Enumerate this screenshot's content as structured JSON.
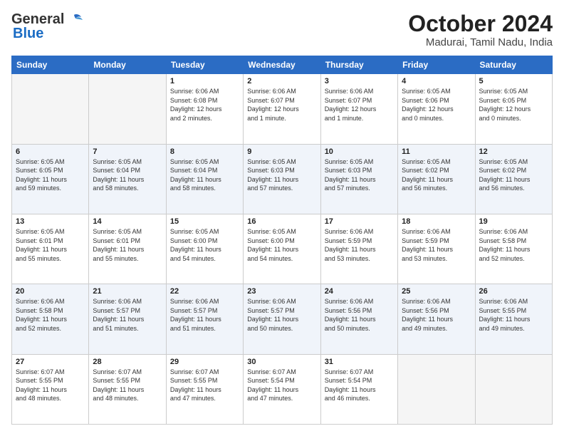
{
  "header": {
    "logo_general": "General",
    "logo_blue": "Blue",
    "month": "October 2024",
    "location": "Madurai, Tamil Nadu, India"
  },
  "weekdays": [
    "Sunday",
    "Monday",
    "Tuesday",
    "Wednesday",
    "Thursday",
    "Friday",
    "Saturday"
  ],
  "weeks": [
    [
      {
        "day": null,
        "info": ""
      },
      {
        "day": null,
        "info": ""
      },
      {
        "day": "1",
        "info": "Sunrise: 6:06 AM\nSunset: 6:08 PM\nDaylight: 12 hours\nand 2 minutes."
      },
      {
        "day": "2",
        "info": "Sunrise: 6:06 AM\nSunset: 6:07 PM\nDaylight: 12 hours\nand 1 minute."
      },
      {
        "day": "3",
        "info": "Sunrise: 6:06 AM\nSunset: 6:07 PM\nDaylight: 12 hours\nand 1 minute."
      },
      {
        "day": "4",
        "info": "Sunrise: 6:05 AM\nSunset: 6:06 PM\nDaylight: 12 hours\nand 0 minutes."
      },
      {
        "day": "5",
        "info": "Sunrise: 6:05 AM\nSunset: 6:05 PM\nDaylight: 12 hours\nand 0 minutes."
      }
    ],
    [
      {
        "day": "6",
        "info": "Sunrise: 6:05 AM\nSunset: 6:05 PM\nDaylight: 11 hours\nand 59 minutes."
      },
      {
        "day": "7",
        "info": "Sunrise: 6:05 AM\nSunset: 6:04 PM\nDaylight: 11 hours\nand 58 minutes."
      },
      {
        "day": "8",
        "info": "Sunrise: 6:05 AM\nSunset: 6:04 PM\nDaylight: 11 hours\nand 58 minutes."
      },
      {
        "day": "9",
        "info": "Sunrise: 6:05 AM\nSunset: 6:03 PM\nDaylight: 11 hours\nand 57 minutes."
      },
      {
        "day": "10",
        "info": "Sunrise: 6:05 AM\nSunset: 6:03 PM\nDaylight: 11 hours\nand 57 minutes."
      },
      {
        "day": "11",
        "info": "Sunrise: 6:05 AM\nSunset: 6:02 PM\nDaylight: 11 hours\nand 56 minutes."
      },
      {
        "day": "12",
        "info": "Sunrise: 6:05 AM\nSunset: 6:02 PM\nDaylight: 11 hours\nand 56 minutes."
      }
    ],
    [
      {
        "day": "13",
        "info": "Sunrise: 6:05 AM\nSunset: 6:01 PM\nDaylight: 11 hours\nand 55 minutes."
      },
      {
        "day": "14",
        "info": "Sunrise: 6:05 AM\nSunset: 6:01 PM\nDaylight: 11 hours\nand 55 minutes."
      },
      {
        "day": "15",
        "info": "Sunrise: 6:05 AM\nSunset: 6:00 PM\nDaylight: 11 hours\nand 54 minutes."
      },
      {
        "day": "16",
        "info": "Sunrise: 6:05 AM\nSunset: 6:00 PM\nDaylight: 11 hours\nand 54 minutes."
      },
      {
        "day": "17",
        "info": "Sunrise: 6:06 AM\nSunset: 5:59 PM\nDaylight: 11 hours\nand 53 minutes."
      },
      {
        "day": "18",
        "info": "Sunrise: 6:06 AM\nSunset: 5:59 PM\nDaylight: 11 hours\nand 53 minutes."
      },
      {
        "day": "19",
        "info": "Sunrise: 6:06 AM\nSunset: 5:58 PM\nDaylight: 11 hours\nand 52 minutes."
      }
    ],
    [
      {
        "day": "20",
        "info": "Sunrise: 6:06 AM\nSunset: 5:58 PM\nDaylight: 11 hours\nand 52 minutes."
      },
      {
        "day": "21",
        "info": "Sunrise: 6:06 AM\nSunset: 5:57 PM\nDaylight: 11 hours\nand 51 minutes."
      },
      {
        "day": "22",
        "info": "Sunrise: 6:06 AM\nSunset: 5:57 PM\nDaylight: 11 hours\nand 51 minutes."
      },
      {
        "day": "23",
        "info": "Sunrise: 6:06 AM\nSunset: 5:57 PM\nDaylight: 11 hours\nand 50 minutes."
      },
      {
        "day": "24",
        "info": "Sunrise: 6:06 AM\nSunset: 5:56 PM\nDaylight: 11 hours\nand 50 minutes."
      },
      {
        "day": "25",
        "info": "Sunrise: 6:06 AM\nSunset: 5:56 PM\nDaylight: 11 hours\nand 49 minutes."
      },
      {
        "day": "26",
        "info": "Sunrise: 6:06 AM\nSunset: 5:55 PM\nDaylight: 11 hours\nand 49 minutes."
      }
    ],
    [
      {
        "day": "27",
        "info": "Sunrise: 6:07 AM\nSunset: 5:55 PM\nDaylight: 11 hours\nand 48 minutes."
      },
      {
        "day": "28",
        "info": "Sunrise: 6:07 AM\nSunset: 5:55 PM\nDaylight: 11 hours\nand 48 minutes."
      },
      {
        "day": "29",
        "info": "Sunrise: 6:07 AM\nSunset: 5:55 PM\nDaylight: 11 hours\nand 47 minutes."
      },
      {
        "day": "30",
        "info": "Sunrise: 6:07 AM\nSunset: 5:54 PM\nDaylight: 11 hours\nand 47 minutes."
      },
      {
        "day": "31",
        "info": "Sunrise: 6:07 AM\nSunset: 5:54 PM\nDaylight: 11 hours\nand 46 minutes."
      },
      {
        "day": null,
        "info": ""
      },
      {
        "day": null,
        "info": ""
      }
    ]
  ]
}
